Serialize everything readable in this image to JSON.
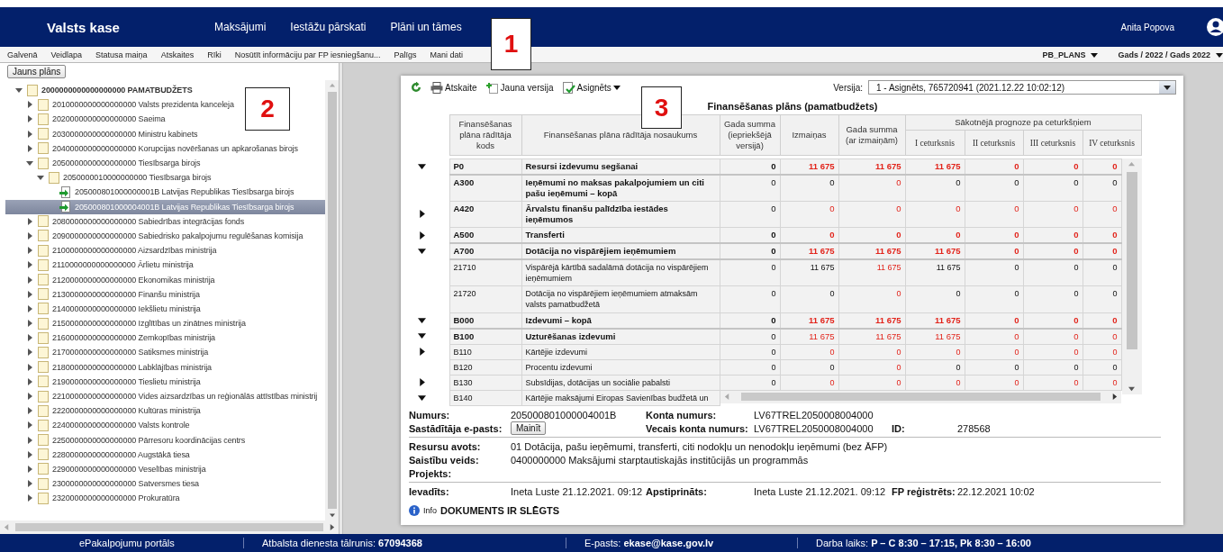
{
  "header": {
    "brand": "Valsts kase",
    "nav": [
      {
        "label": "Maksājumi"
      },
      {
        "label": "Iestāžu pārskati"
      },
      {
        "label": "Plāni un tāmes"
      }
    ],
    "user": "Anita Popova"
  },
  "menu": {
    "items": [
      "Galvenā",
      "Veidlapa",
      "Statusa maiņa",
      "Atskaites",
      "Rīki",
      "Nosūtīt informāciju par FP iesniegšanu...",
      "Palīgs",
      "Mani dati"
    ],
    "dropdowns": [
      "PB_PLANS",
      "Gads / 2022 / Gads 2022"
    ]
  },
  "left_panel": {
    "new_button": "Jauns plāns",
    "tree": [
      {
        "label": "2000000000000000000 PAMATBUDŽETS",
        "kind": "folder",
        "expanded": true,
        "selected": false,
        "children": [
          {
            "label": "2010000000000000000 Valsts prezidenta kanceleja",
            "kind": "folder",
            "expanded": false,
            "selected": false
          },
          {
            "label": "2020000000000000000 Saeima",
            "kind": "folder",
            "expanded": false,
            "selected": false
          },
          {
            "label": "2030000000000000000 Ministru kabinets",
            "kind": "folder",
            "expanded": false,
            "selected": false
          },
          {
            "label": "2040000000000000000 Korupcijas novēršanas un apkarošanas birojs",
            "kind": "folder",
            "expanded": false,
            "selected": false
          },
          {
            "label": "2050000000000000000 Tiesībsarga birojs",
            "kind": "folder",
            "expanded": true,
            "selected": false,
            "children": [
              {
                "label": "2050000010000000000 Tiesībsarga birojs",
                "kind": "folder",
                "expanded": true,
                "selected": false,
                "children": [
                  {
                    "label": "205000801000000001B Latvijas Republikas Tiesībsarga birojs",
                    "kind": "document",
                    "selected": false
                  },
                  {
                    "label": "205000801000004001B Latvijas Republikas Tiesībsarga birojs",
                    "kind": "document",
                    "selected": true
                  }
                ]
              }
            ]
          },
          {
            "label": "2080000000000000000 Sabiedrības integrācijas fonds",
            "kind": "folder",
            "expanded": false,
            "selected": false
          },
          {
            "label": "2090000000000000000 Sabiedrisko pakalpojumu regulēšanas komisija",
            "kind": "folder",
            "expanded": false,
            "selected": false
          },
          {
            "label": "2100000000000000000 Aizsardzības ministrija",
            "kind": "folder",
            "expanded": false,
            "selected": false
          },
          {
            "label": "2110000000000000000 Ārlietu ministrija",
            "kind": "folder",
            "expanded": false,
            "selected": false
          },
          {
            "label": "2120000000000000000 Ekonomikas ministrija",
            "kind": "folder",
            "expanded": false,
            "selected": false
          },
          {
            "label": "2130000000000000000 Finanšu ministrija",
            "kind": "folder",
            "expanded": false,
            "selected": false
          },
          {
            "label": "2140000000000000000 Iekšlietu ministrija",
            "kind": "folder",
            "expanded": false,
            "selected": false
          },
          {
            "label": "2150000000000000000 Izglītības un zinātnes ministrija",
            "kind": "folder",
            "expanded": false,
            "selected": false
          },
          {
            "label": "2160000000000000000 Zemkopības ministrija",
            "kind": "folder",
            "expanded": false,
            "selected": false
          },
          {
            "label": "2170000000000000000 Satiksmes ministrija",
            "kind": "folder",
            "expanded": false,
            "selected": false
          },
          {
            "label": "2180000000000000000 Labklājības ministrija",
            "kind": "folder",
            "expanded": false,
            "selected": false
          },
          {
            "label": "2190000000000000000 Tieslietu ministrija",
            "kind": "folder",
            "expanded": false,
            "selected": false
          },
          {
            "label": "2210000000000000000 Vides aizsardzības un reģionālās attīstības ministrij",
            "kind": "folder",
            "expanded": false,
            "selected": false
          },
          {
            "label": "2220000000000000000 Kultūras ministrija",
            "kind": "folder",
            "expanded": false,
            "selected": false
          },
          {
            "label": "2240000000000000000 Valsts kontrole",
            "kind": "folder",
            "expanded": false,
            "selected": false
          },
          {
            "label": "2250000000000000000 Pārresoru koordinācijas centrs",
            "kind": "folder",
            "expanded": false,
            "selected": false
          },
          {
            "label": "2280000000000000000 Augstākā tiesa",
            "kind": "folder",
            "expanded": false,
            "selected": false
          },
          {
            "label": "2290000000000000000 Veselības ministrija",
            "kind": "folder",
            "expanded": false,
            "selected": false
          },
          {
            "label": "2300000000000000000 Satversmes tiesa",
            "kind": "folder",
            "expanded": false,
            "selected": false
          },
          {
            "label": "2320000000000000000 Prokuratūra",
            "kind": "folder",
            "expanded": false,
            "selected": false
          }
        ]
      }
    ]
  },
  "document": {
    "toolbar": [
      {
        "kind": "refresh"
      },
      {
        "kind": "print",
        "label": "Atskaite"
      },
      {
        "kind": "new",
        "label": "Jauna versija"
      },
      {
        "kind": "assign",
        "label": "Asignēts"
      }
    ],
    "version_label": "Versija:",
    "version_value": "1 - Asignēts, 765720941 (2021.12.22 10:02:12)",
    "title": "Finansēšanas plāns (pamatbudžets)",
    "table": {
      "columns": [
        "Finansēšanas plāna rādītāja kods",
        "Finansēšanas plāna rādītāja nosaukums",
        "Gada summa (iepriekšējā versijā)",
        "Izmaiņas",
        "Gada summa (ar izmaiņām)"
      ],
      "group": {
        "label": "Sākotnējā prognoze pa ceturkšņiem",
        "columns": [
          "I ceturksnis",
          "II ceturksnis",
          "III ceturksnis",
          "IV ceturksnis"
        ]
      },
      "rows": [
        {
          "code": "P0",
          "name": "Resursi izdevumu segšanai",
          "kind": "total",
          "expanded": true,
          "values": [
            "0",
            "11 675",
            "11 675",
            "11 675",
            "0",
            "0",
            "0"
          ],
          "changed": [
            false,
            true,
            true,
            true,
            true,
            true,
            true
          ]
        },
        {
          "code": "A300",
          "name": "Ieņēmumi no maksas pakalpojumiem un citi pašu ieņēmumi – kopā",
          "kind": "group",
          "values": [
            "0",
            "0",
            "0",
            "0",
            "0",
            "0",
            "0"
          ],
          "changed": [
            false,
            false,
            true,
            false,
            false,
            false,
            false
          ]
        },
        {
          "code": "A420",
          "name": "Ārvalstu finanšu palīdzība iestādes ieņēmumos",
          "kind": "group",
          "expanded": false,
          "values": [
            "0",
            "0",
            "0",
            "0",
            "0",
            "0",
            "0"
          ],
          "changed": [
            false,
            true,
            true,
            true,
            true,
            true,
            true
          ]
        },
        {
          "code": "A500",
          "name": "Transferti",
          "kind": "total",
          "expanded": false,
          "values": [
            "0",
            "0",
            "0",
            "0",
            "0",
            "0",
            "0"
          ],
          "changed": [
            false,
            true,
            true,
            true,
            true,
            true,
            true
          ]
        },
        {
          "code": "A700",
          "name": "Dotācija no vispārējiem ieņēmumiem",
          "kind": "total",
          "expanded": true,
          "values": [
            "0",
            "11 675",
            "11 675",
            "11 675",
            "0",
            "0",
            "0"
          ],
          "changed": [
            false,
            true,
            true,
            true,
            true,
            true,
            true
          ]
        },
        {
          "code": "21710",
          "name": "Vispārējā kārtībā sadalāmā dotācija no vispārējiem ieņēmumiem",
          "kind": "item",
          "values": [
            "0",
            "11 675",
            "11 675",
            "11 675",
            "0",
            "0",
            "0"
          ],
          "changed": [
            false,
            false,
            true,
            false,
            false,
            false,
            false
          ]
        },
        {
          "code": "21720",
          "name": "Dotācija no vispārējiem ieņēmumiem atmaksām valsts pamatbudžetā",
          "kind": "item",
          "values": [
            "0",
            "0",
            "0",
            "0",
            "0",
            "0",
            "0"
          ],
          "changed": [
            false,
            false,
            true,
            false,
            false,
            false,
            false
          ]
        },
        {
          "code": "B000",
          "name": "Izdevumi – kopā",
          "kind": "total",
          "expanded": true,
          "values": [
            "0",
            "11 675",
            "11 675",
            "11 675",
            "0",
            "0",
            "0"
          ],
          "changed": [
            false,
            true,
            true,
            true,
            true,
            true,
            true
          ]
        },
        {
          "code": "B100",
          "name": "Uzturēšanas izdevumi",
          "kind": "group",
          "expanded": true,
          "values": [
            "0",
            "11 675",
            "11 675",
            "11 675",
            "0",
            "0",
            "0"
          ],
          "changed": [
            false,
            true,
            true,
            true,
            true,
            true,
            true
          ]
        },
        {
          "code": "B110",
          "name": "Kārtējie izdevumi",
          "kind": "item",
          "expanded": false,
          "values": [
            "0",
            "0",
            "0",
            "0",
            "0",
            "0",
            "0"
          ],
          "changed": [
            false,
            true,
            true,
            true,
            true,
            true,
            true
          ]
        },
        {
          "code": "B120",
          "name": "Procentu izdevumi",
          "kind": "item",
          "values": [
            "0",
            "0",
            "0",
            "0",
            "0",
            "0",
            "0"
          ],
          "changed": [
            false,
            false,
            true,
            false,
            false,
            false,
            false
          ]
        },
        {
          "code": "B130",
          "name": "Subsīdijas, dotācijas un sociālie pabalsti",
          "kind": "item",
          "expanded": false,
          "values": [
            "0",
            "0",
            "0",
            "0",
            "0",
            "0",
            "0"
          ],
          "changed": [
            false,
            true,
            true,
            true,
            true,
            true,
            true
          ]
        },
        {
          "code": "B140",
          "name": "Kārtējie maksājumi Eiropas Savienības budžetā un",
          "kind": "item",
          "expanded": true
        }
      ]
    },
    "details": [
      {
        "rows": [
          {
            "fields": [
              {
                "label": "Numurs:",
                "value": "205000801000004001B"
              },
              {
                "label": "Konta numurs:",
                "value": "LV67TREL2050008004000"
              }
            ]
          },
          {
            "fields": [
              {
                "label": "Sastādītāja e-pasts:",
                "button": "Mainīt"
              },
              {
                "label": "Vecais konta numurs:",
                "value": "LV67TREL2050008004000"
              },
              {
                "label": "ID:",
                "value": "278568"
              }
            ]
          }
        ]
      },
      {
        "rows": [
          {
            "fields": [
              {
                "label": "Resursu avots:",
                "value": "01 Dotācija, pašu ieņēmumi, transferti, citi nodokļu un nenodokļu ieņēmumi (bez ĀFP)"
              }
            ]
          },
          {
            "fields": [
              {
                "label": "Saistību veids:",
                "value": "0400000000 Maksājumi starptautiskajās institūcijās un programmās"
              }
            ]
          },
          {
            "fields": [
              {
                "label": "Projekts:"
              }
            ]
          }
        ]
      },
      {
        "rows": [
          {
            "fields": [
              {
                "label": "Ievadīts:",
                "value": "Ineta Luste 21.12.2021. 09:12"
              },
              {
                "label": "Apstiprināts:",
                "value": "Ineta Luste 21.12.2021. 09:12"
              },
              {
                "label": "FP reģistrēts:",
                "value": "22.12.2021 10:02"
              }
            ]
          }
        ]
      }
    ],
    "info": {
      "label": "Info",
      "message": "DOKUMENTS IR SLĒGTS"
    }
  },
  "annotations": [
    {
      "label": "1"
    },
    {
      "label": "2"
    },
    {
      "label": "3"
    }
  ],
  "footer": [
    "ePakalpojumu portāls",
    "Atbalsta dienesta tālrunis: **67094368**",
    "E-pasts: **ekase@kase.gov.lv**",
    "Darba laiks: **P – C 8:30 – 17:15, Pk 8:30 – 16:00**"
  ]
}
